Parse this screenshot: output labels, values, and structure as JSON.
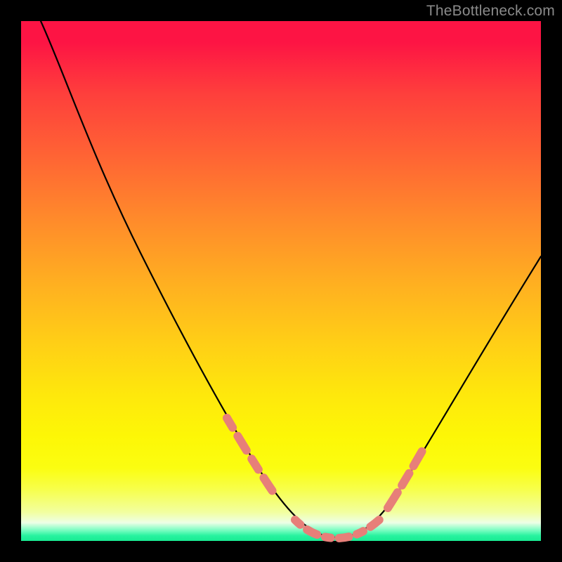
{
  "watermark": "TheBottleneck.com",
  "chart_data": {
    "type": "line",
    "title": "",
    "xlabel": "",
    "ylabel": "",
    "xlim": [
      0,
      100
    ],
    "ylim": [
      0,
      100
    ],
    "grid": false,
    "legend": false,
    "series": [
      {
        "name": "bottleneck-curve",
        "x": [
          4,
          8,
          12,
          16,
          20,
          24,
          28,
          32,
          36,
          40,
          44,
          48,
          52,
          56,
          58,
          60,
          62,
          64,
          68,
          72,
          76,
          80,
          84,
          88,
          92,
          96,
          100
        ],
        "values": [
          100,
          94,
          87,
          80,
          73,
          66,
          58,
          51,
          43,
          36,
          28,
          20,
          12,
          5,
          2,
          1,
          1,
          2,
          5,
          10,
          16,
          23,
          30,
          37,
          44,
          50,
          56
        ]
      }
    ],
    "annotations": {
      "pink_dash_segments": [
        {
          "x_range": [
            38,
            46
          ],
          "side": "left-descent"
        },
        {
          "x_range": [
            52,
            70
          ],
          "side": "valley"
        },
        {
          "x_range": [
            70,
            76
          ],
          "side": "right-ascent"
        }
      ]
    },
    "background_gradient": {
      "stops": [
        {
          "pos": 0.0,
          "color": "#fd1444"
        },
        {
          "pos": 0.5,
          "color": "#ffae21"
        },
        {
          "pos": 0.8,
          "color": "#fdf706"
        },
        {
          "pos": 0.965,
          "color": "#edffe6"
        },
        {
          "pos": 1.0,
          "color": "#19ea92"
        }
      ]
    }
  }
}
